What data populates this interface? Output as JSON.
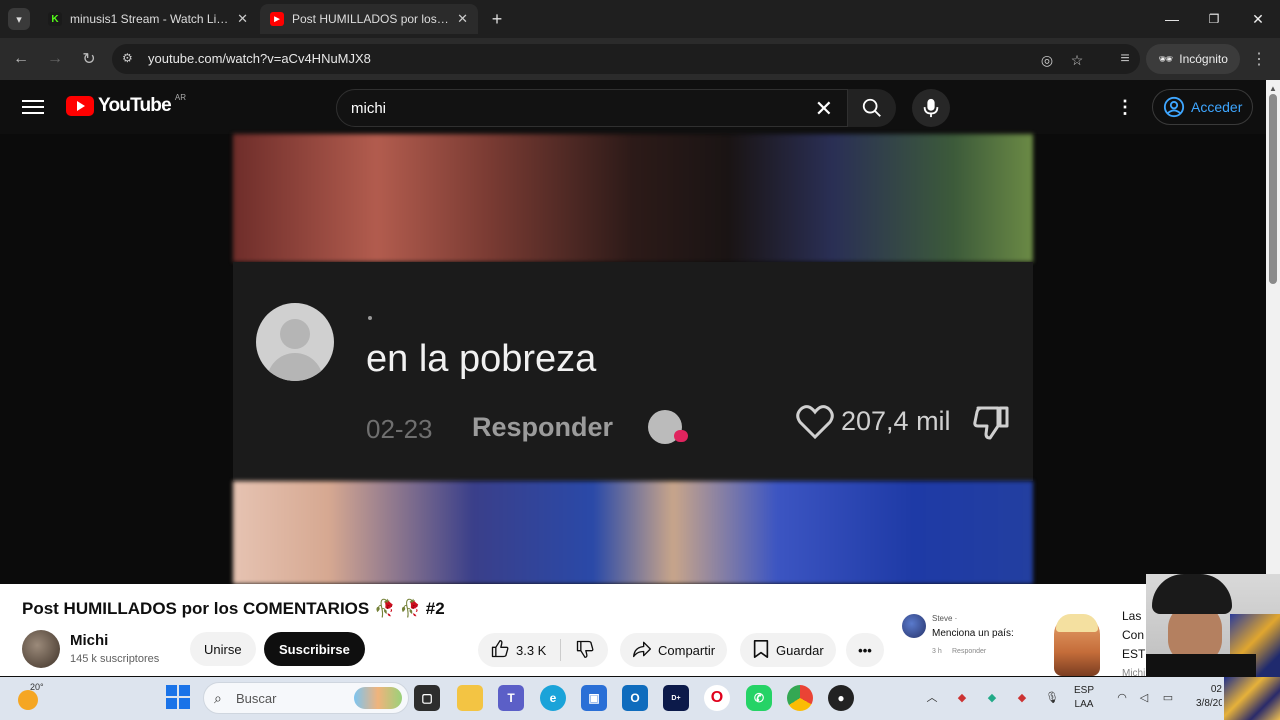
{
  "browser": {
    "tabs": [
      {
        "title": "minusis1 Stream - Watch Live o",
        "favicon": "kick-icon",
        "active": false
      },
      {
        "title": "Post HUMILLADOS por los COM",
        "favicon": "youtube-icon",
        "active": true
      }
    ],
    "url": "youtube.com/watch?v=aCv4HNuMJX8",
    "incognito_label": "Incógnito"
  },
  "youtube": {
    "logo_text": "YouTube",
    "country_code": "AR",
    "search_query": "michi",
    "signin_label": "Acceder"
  },
  "comment": {
    "username": "·",
    "text": "en la pobreza",
    "date": "02-23",
    "reply_label": "Responder",
    "likes": "207,4 mil"
  },
  "video": {
    "title": "Post HUMILLADOS por los COMENTARIOS 🥀 🥀 #2",
    "channel": "Michi",
    "subscribers": "145 k suscriptores",
    "join_label": "Unirse",
    "subscribe_label": "Suscribirse",
    "likes": "3.3 K",
    "share_label": "Compartir",
    "save_label": "Guardar"
  },
  "snippet": {
    "user": "Steve ·",
    "text": "Menciona un país:",
    "time": "3 h",
    "reply": "Responder",
    "right_lines": [
      "Las",
      "Con",
      "EST",
      "Michi"
    ]
  },
  "taskbar": {
    "temperature": "20°",
    "search_label": "Buscar",
    "lang_line1": "ESP",
    "lang_line2": "LAA",
    "time": "02",
    "date": "3/8/20"
  },
  "colors": {
    "yt_red": "#ff0000",
    "link_blue": "#3ea6ff",
    "dark_bg": "#0f0f0f"
  }
}
